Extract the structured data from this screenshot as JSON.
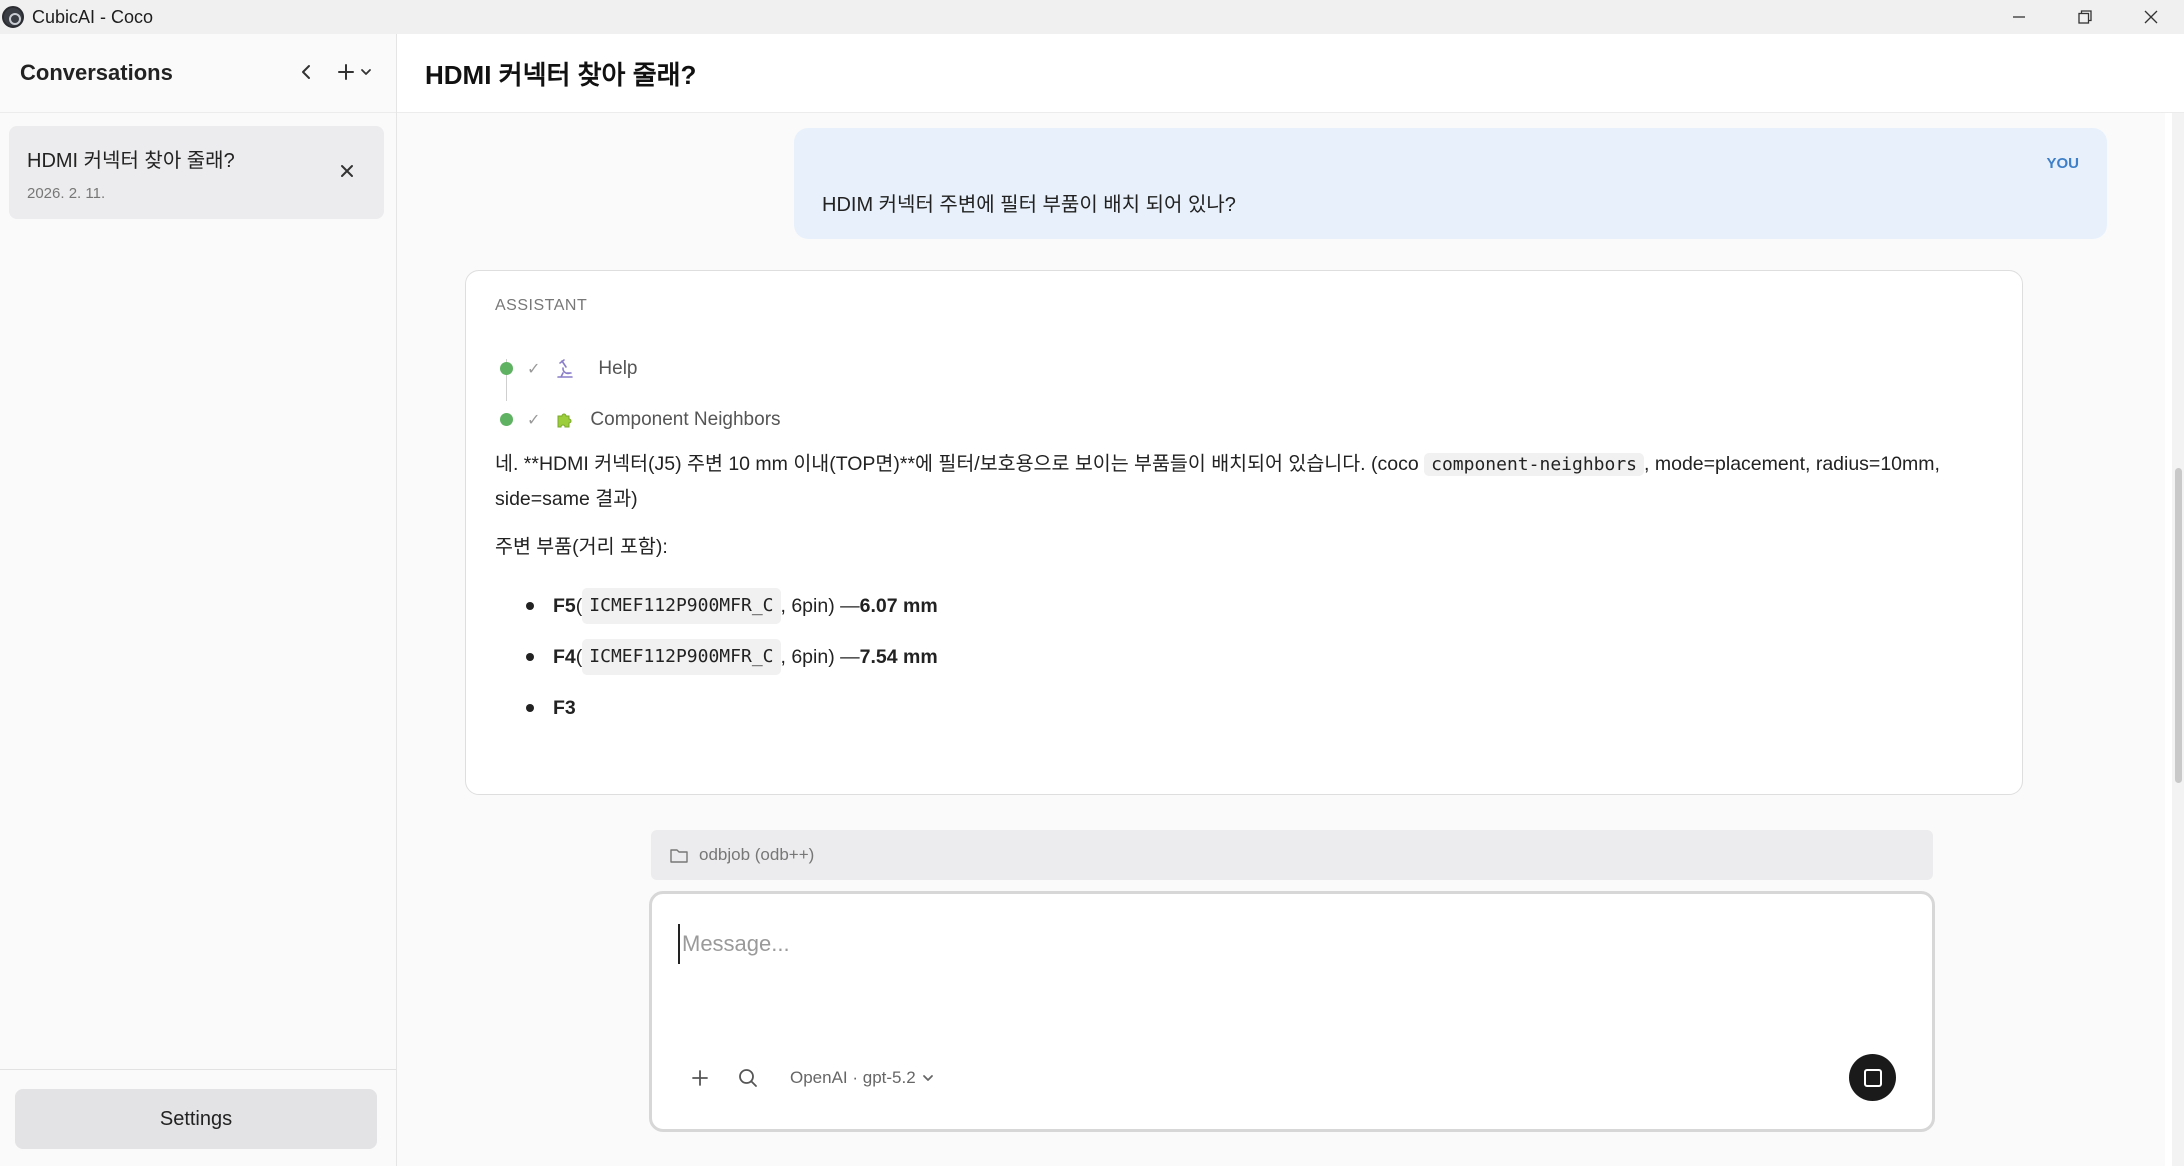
{
  "window": {
    "title": "CubicAI - Coco"
  },
  "sidebar": {
    "title": "Conversations",
    "conversations": [
      {
        "title": "HDMI 커넥터 찾아 줄래?",
        "date": "2026. 2. 11."
      }
    ],
    "settings_label": "Settings"
  },
  "main": {
    "title": "HDMI 커넥터 찾아 줄래?"
  },
  "messages": {
    "user": {
      "role_label": "YOU",
      "text": "HDIM 커넥터 주변에 필터 부품이 배치 되어 있나?"
    },
    "assistant": {
      "role_label": "ASSISTANT",
      "steps": [
        {
          "label": "Help",
          "icon": "microscope-icon"
        },
        {
          "label": "Component Neighbors",
          "icon": "puzzle-icon"
        }
      ],
      "para1_before": "네. **HDMI 커넥터(J5) 주변 10 mm 이내(TOP면)**에 필터/보호용으로 보이는 부품들이 배치되어 있습니다. (coco ",
      "para1_code": "component-neighbors",
      "para1_after": ", mode=placement, radius=10mm, side=same 결과)",
      "para2": "주변 부품(거리 포함):",
      "items": [
        {
          "ref": "F5",
          "open": " (",
          "part": "ICMEF112P900MFR_C",
          "close": ", 6pin) — ",
          "dist": "6.07 mm"
        },
        {
          "ref": "F4",
          "open": " (",
          "part": "ICMEF112P900MFR_C",
          "close": ", 6pin) — ",
          "dist": "7.54 mm"
        },
        {
          "ref": "F3"
        }
      ]
    }
  },
  "workspace": {
    "label": "odbjob (odb++)"
  },
  "composer": {
    "placeholder": "Message...",
    "model": "OpenAI · gpt-5.2"
  },
  "colors": {
    "accent": "#3d7fc8",
    "status_done": "#5fb261",
    "user_bubble": "#e8f1fb"
  }
}
